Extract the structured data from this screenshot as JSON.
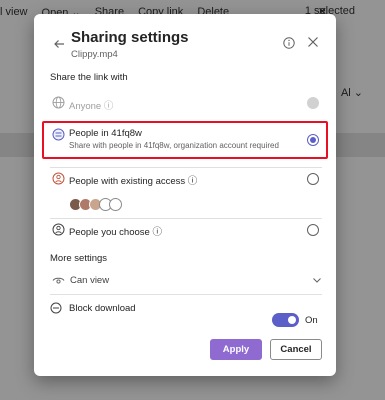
{
  "background": {
    "toolbar": [
      "l view",
      "Open ⌄",
      "Share",
      "Copy link",
      "Delete"
    ],
    "close": "✕",
    "selected_count": "1 selected",
    "right_label": "Al ⌄"
  },
  "dialog": {
    "title": "Sharing settings",
    "subtitle": "Clippy.mp4",
    "share_link_label": "Share the link with",
    "options": [
      {
        "title": "Anyone ⓘ",
        "desc": "",
        "state": "disabled"
      },
      {
        "title": "People in 41fq8w",
        "desc": "Share with people in 41fq8w, organization account required",
        "state": "checked"
      },
      {
        "title": "People with existing access ⓘ",
        "desc": "",
        "state": "unchecked"
      },
      {
        "title": "People you choose ⓘ",
        "desc": "",
        "state": "unchecked"
      }
    ],
    "more_settings_label": "More settings",
    "permission": "Can view",
    "block_download_label": "Block download",
    "block_download_state": "On",
    "apply_label": "Apply",
    "cancel_label": "Cancel",
    "accent_color": "#5b5fc7",
    "highlight_color": "#e81123"
  }
}
